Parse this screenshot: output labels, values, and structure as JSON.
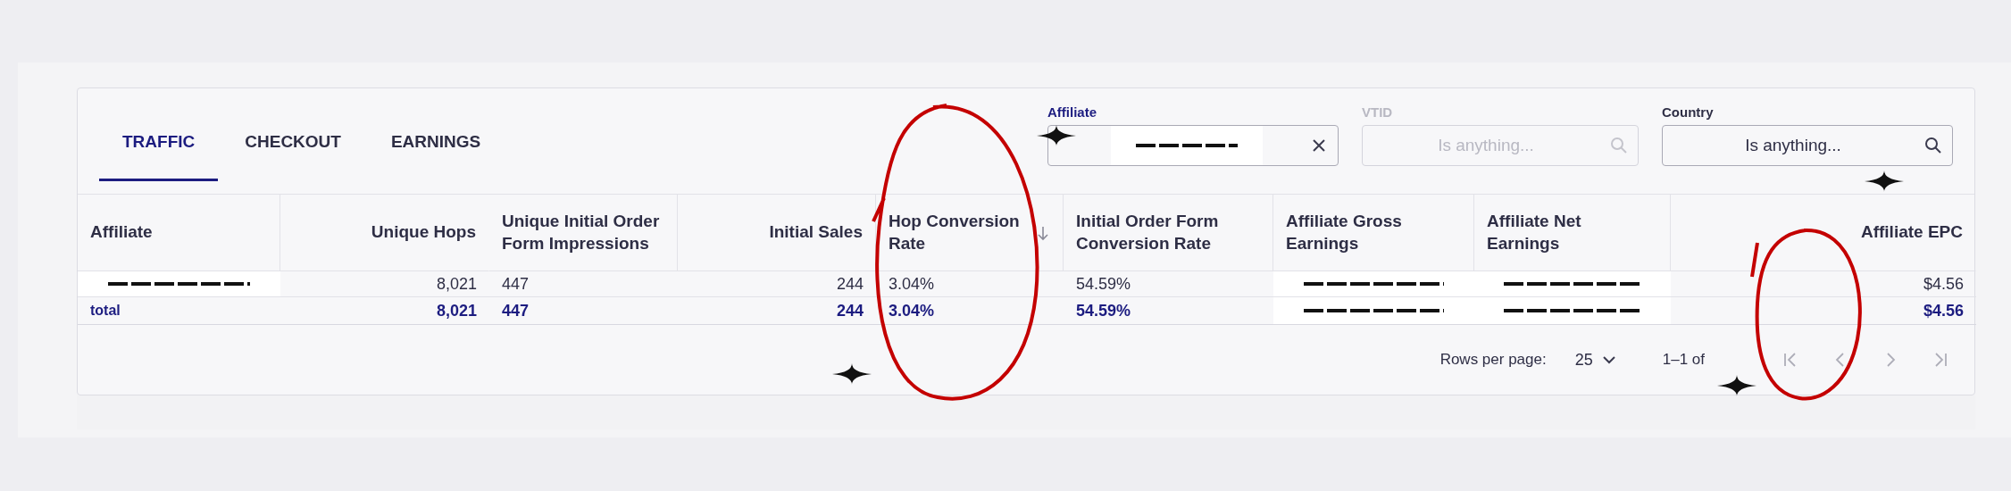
{
  "tabs": [
    {
      "label": "TRAFFIC",
      "selected": true
    },
    {
      "label": "CHECKOUT",
      "selected": false
    },
    {
      "label": "EARNINGS",
      "selected": false
    }
  ],
  "filters": [
    {
      "label": "Affiliate",
      "kind": "redacted",
      "active": true,
      "disabled": false,
      "clearable": true
    },
    {
      "label": "VTID",
      "kind": "field",
      "placeholder": "Is anything...",
      "active": false,
      "disabled": true,
      "clearable": false
    },
    {
      "label": "Country",
      "kind": "field",
      "placeholder": "Is anything...",
      "active": false,
      "disabled": false,
      "clearable": false
    }
  ],
  "table": {
    "columns": [
      {
        "label": "Affiliate",
        "numeric": false,
        "sorted_desc": false
      },
      {
        "label": "Unique Hops",
        "numeric": true,
        "sorted_desc": false
      },
      {
        "label": "Unique Initial Order Form Impressions",
        "numeric": false,
        "sorted_desc": false
      },
      {
        "label": "Initial Sales",
        "numeric": true,
        "sorted_desc": false
      },
      {
        "label": "Hop Conversion Rate",
        "numeric": false,
        "sorted_desc": true
      },
      {
        "label": "Initial Order Form Conversion Rate",
        "numeric": false,
        "sorted_desc": false
      },
      {
        "label": "Affiliate Gross Earnings",
        "numeric": false,
        "sorted_desc": false
      },
      {
        "label": "Affiliate Net Earnings",
        "numeric": false,
        "sorted_desc": false
      },
      {
        "label": "Affiliate EPC",
        "numeric": true,
        "sorted_desc": false
      }
    ],
    "rows": [
      {
        "kind": "data",
        "cells": [
          {
            "kind": "redacted"
          },
          {
            "kind": "text",
            "text": "8,021"
          },
          {
            "kind": "text",
            "text": "447"
          },
          {
            "kind": "text",
            "text": "244"
          },
          {
            "kind": "text",
            "text": "3.04%"
          },
          {
            "kind": "text",
            "text": "54.59%"
          },
          {
            "kind": "redacted"
          },
          {
            "kind": "redacted"
          },
          {
            "kind": "text",
            "text": "$4.56"
          }
        ]
      },
      {
        "kind": "total",
        "cells": [
          {
            "kind": "text",
            "text": "total"
          },
          {
            "kind": "text",
            "text": "8,021"
          },
          {
            "kind": "text",
            "text": "447"
          },
          {
            "kind": "text",
            "text": "244"
          },
          {
            "kind": "text",
            "text": "3.04%"
          },
          {
            "kind": "text",
            "text": "54.59%"
          },
          {
            "kind": "redacted"
          },
          {
            "kind": "redacted"
          },
          {
            "kind": "text",
            "text": "$4.56"
          }
        ]
      }
    ]
  },
  "pagination": {
    "rows_label": "Rows per page:",
    "rows_value": "25",
    "range": "1–1 of",
    "buttons": [
      {
        "kind": "first",
        "disabled": true
      },
      {
        "kind": "prev",
        "disabled": true
      },
      {
        "kind": "next",
        "disabled": true
      },
      {
        "kind": "last",
        "disabled": true
      }
    ]
  }
}
